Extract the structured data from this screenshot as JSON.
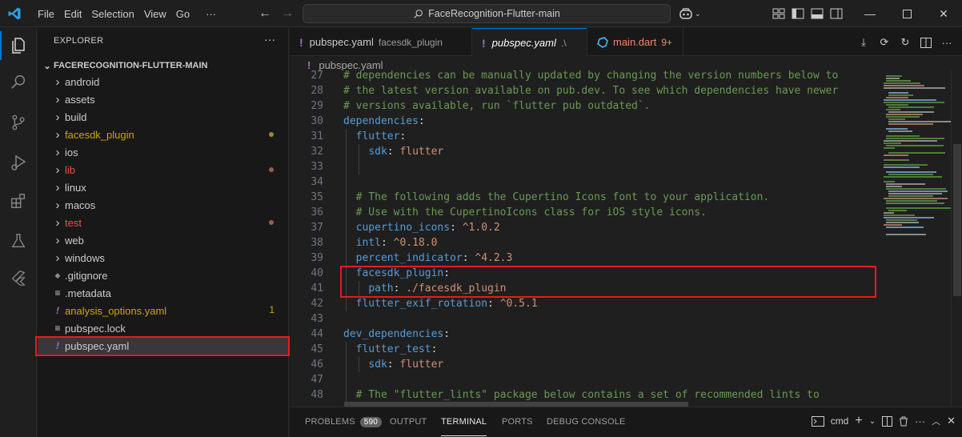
{
  "titlebar": {
    "menu": [
      "File",
      "Edit",
      "Selection",
      "View",
      "Go",
      "···"
    ],
    "search_text": "FaceRecognition-Flutter-main",
    "window_controls": [
      "minimize",
      "maximize",
      "close"
    ]
  },
  "activity_bar": [
    "explorer-icon",
    "search-icon",
    "source-control-icon",
    "run-debug-icon",
    "extensions-icon",
    "testing-icon",
    "flutter-icon"
  ],
  "sidebar": {
    "header": "EXPLORER",
    "more": "···",
    "root": "FACERECOGNITION-FLUTTER-MAIN",
    "items": [
      {
        "label": "android",
        "type": "folder",
        "color": "#cccccc"
      },
      {
        "label": "assets",
        "type": "folder",
        "color": "#cccccc"
      },
      {
        "label": "build",
        "type": "folder",
        "color": "#cccccc"
      },
      {
        "label": "facesdk_plugin",
        "type": "folder",
        "color": "#cca700",
        "dot": "#9e8a2a"
      },
      {
        "label": "ios",
        "type": "folder",
        "color": "#cccccc"
      },
      {
        "label": "lib",
        "type": "folder",
        "color": "#f14c4c",
        "dot": "#9e5a4e"
      },
      {
        "label": "linux",
        "type": "folder",
        "color": "#cccccc"
      },
      {
        "label": "macos",
        "type": "folder",
        "color": "#cccccc"
      },
      {
        "label": "test",
        "type": "folder",
        "color": "#f14c4c",
        "dot": "#9e5a4e"
      },
      {
        "label": "web",
        "type": "folder",
        "color": "#cccccc"
      },
      {
        "label": "windows",
        "type": "folder",
        "color": "#cccccc"
      },
      {
        "label": ".gitignore",
        "type": "git",
        "color": "#cccccc"
      },
      {
        "label": ".metadata",
        "type": "lines",
        "color": "#cccccc"
      },
      {
        "label": "analysis_options.yaml",
        "type": "yaml",
        "color": "#cca700",
        "badge": "1"
      },
      {
        "label": "pubspec.lock",
        "type": "lines",
        "color": "#cccccc"
      },
      {
        "label": "pubspec.yaml",
        "type": "yaml",
        "color": "#cccccc",
        "selected": true
      }
    ]
  },
  "tabs": [
    {
      "label": "pubspec.yaml",
      "sub": "facesdk_plugin",
      "active": false,
      "icon": "yaml"
    },
    {
      "label": "pubspec.yaml",
      "sub": ".\\",
      "active": true,
      "icon": "yaml"
    },
    {
      "label": "main.dart",
      "sub": "9+",
      "active": false,
      "icon": "dart"
    }
  ],
  "breadcrumb": "pubspec.yaml",
  "code_lines": [
    {
      "n": "27",
      "parts": [
        [
          "c-com",
          "# dependencies can be manually updated by changing the version numbers below to"
        ]
      ]
    },
    {
      "n": "28",
      "parts": [
        [
          "c-com",
          "# the latest version available on pub.dev. To see which dependencies have newer"
        ]
      ]
    },
    {
      "n": "29",
      "parts": [
        [
          "c-com",
          "# versions available, run `flutter pub outdated`."
        ]
      ]
    },
    {
      "n": "30",
      "parts": [
        [
          "c-key",
          "dependencies"
        ],
        [
          "c-plain",
          ":"
        ]
      ]
    },
    {
      "n": "31",
      "parts": [
        [
          "c-plain",
          "  "
        ],
        [
          "c-key",
          "flutter"
        ],
        [
          "c-plain",
          ":"
        ]
      ]
    },
    {
      "n": "32",
      "parts": [
        [
          "c-plain",
          "    "
        ],
        [
          "c-key",
          "sdk"
        ],
        [
          "c-plain",
          ": "
        ],
        [
          "c-val",
          "flutter"
        ]
      ]
    },
    {
      "n": "33",
      "parts": []
    },
    {
      "n": "34",
      "parts": []
    },
    {
      "n": "35",
      "parts": [
        [
          "c-plain",
          "  "
        ],
        [
          "c-com",
          "# The following adds the Cupertino Icons font to your application."
        ]
      ]
    },
    {
      "n": "36",
      "parts": [
        [
          "c-plain",
          "  "
        ],
        [
          "c-com",
          "# Use with the CupertinoIcons class for iOS style icons."
        ]
      ]
    },
    {
      "n": "37",
      "parts": [
        [
          "c-plain",
          "  "
        ],
        [
          "c-key",
          "cupertino_icons"
        ],
        [
          "c-plain",
          ": "
        ],
        [
          "c-val",
          "^1.0.2"
        ]
      ]
    },
    {
      "n": "38",
      "parts": [
        [
          "c-plain",
          "  "
        ],
        [
          "c-key",
          "intl"
        ],
        [
          "c-plain",
          ": "
        ],
        [
          "c-val",
          "^0.18.0"
        ]
      ]
    },
    {
      "n": "39",
      "parts": [
        [
          "c-plain",
          "  "
        ],
        [
          "c-key",
          "percent_indicator"
        ],
        [
          "c-plain",
          ": "
        ],
        [
          "c-val",
          "^4.2.3"
        ]
      ]
    },
    {
      "n": "40",
      "parts": [
        [
          "c-plain",
          "  "
        ],
        [
          "c-key",
          "facesdk_plugin"
        ],
        [
          "c-plain",
          ":"
        ]
      ]
    },
    {
      "n": "41",
      "parts": [
        [
          "c-plain",
          "    "
        ],
        [
          "c-key",
          "path"
        ],
        [
          "c-plain",
          ": "
        ],
        [
          "c-val",
          "./facesdk_plugin"
        ]
      ]
    },
    {
      "n": "42",
      "parts": [
        [
          "c-plain",
          "  "
        ],
        [
          "c-key",
          "flutter_exif_rotation"
        ],
        [
          "c-plain",
          ": "
        ],
        [
          "c-val",
          "^0.5.1"
        ]
      ]
    },
    {
      "n": "43",
      "parts": []
    },
    {
      "n": "44",
      "parts": [
        [
          "c-key",
          "dev_dependencies"
        ],
        [
          "c-plain",
          ":"
        ]
      ]
    },
    {
      "n": "45",
      "parts": [
        [
          "c-plain",
          "  "
        ],
        [
          "c-key",
          "flutter_test"
        ],
        [
          "c-plain",
          ":"
        ]
      ]
    },
    {
      "n": "46",
      "parts": [
        [
          "c-plain",
          "    "
        ],
        [
          "c-key",
          "sdk"
        ],
        [
          "c-plain",
          ": "
        ],
        [
          "c-val",
          "flutter"
        ]
      ]
    },
    {
      "n": "47",
      "parts": []
    },
    {
      "n": "48",
      "parts": [
        [
          "c-plain",
          "  "
        ],
        [
          "c-com",
          "# The \"flutter_lints\" package below contains a set of recommended lints to"
        ]
      ]
    }
  ],
  "panel": {
    "tabs": [
      {
        "label": "PROBLEMS",
        "badge": "590"
      },
      {
        "label": "OUTPUT"
      },
      {
        "label": "TERMINAL",
        "active": true
      },
      {
        "label": "PORTS"
      },
      {
        "label": "DEBUG CONSOLE"
      }
    ],
    "terminal_name": "cmd"
  },
  "colors": {
    "accent": "#0078d4",
    "highlight": "#e51b24",
    "yaml_icon": "#a074c4",
    "dart_icon": "#40c4ff"
  }
}
